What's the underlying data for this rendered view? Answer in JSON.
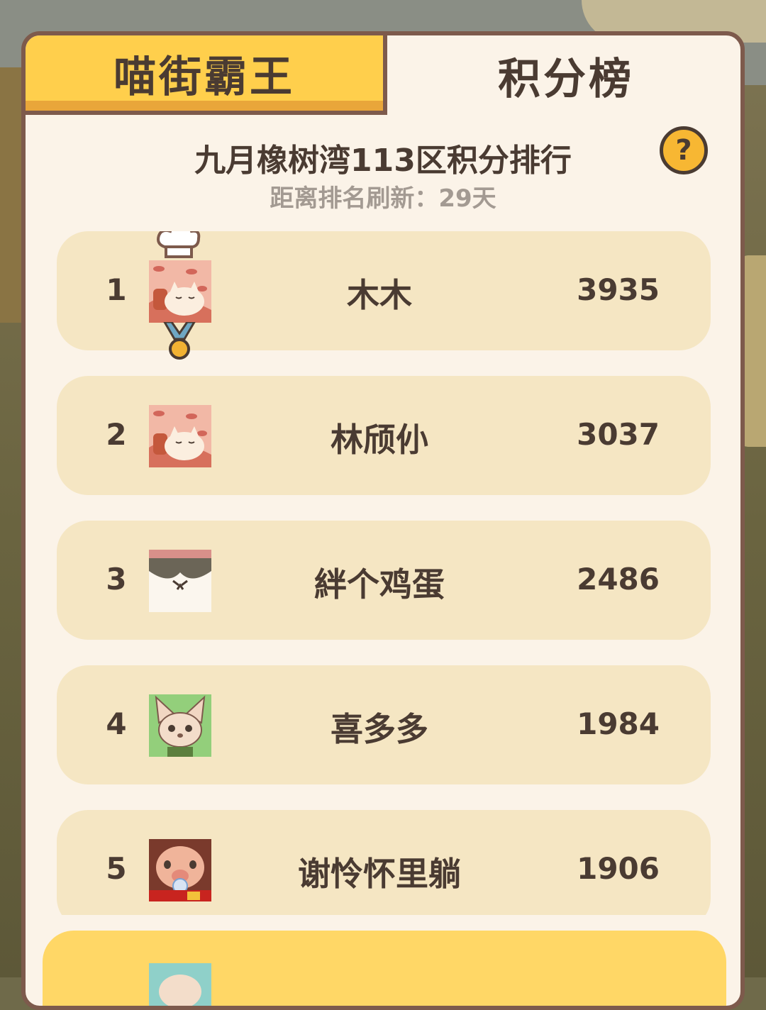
{
  "tabs": [
    {
      "label": "喵街霸王",
      "active": true
    },
    {
      "label": "积分榜",
      "active": false
    }
  ],
  "header": {
    "title": "九月橡树湾113区积分排行",
    "refresh": "距离排名刷新：29天",
    "help_icon": "question-mark-icon"
  },
  "leaderboard": [
    {
      "rank": "1",
      "name": "木木",
      "score": "3935",
      "avatar": "cat-meat-avatar",
      "badges": [
        "chef-hat-icon",
        "gold-medal-icon"
      ]
    },
    {
      "rank": "2",
      "name": "林颀仦",
      "score": "3037",
      "avatar": "cat-meat-avatar"
    },
    {
      "rank": "3",
      "name": "絆个鸡蛋",
      "score": "2486",
      "avatar": "cat-face-avatar"
    },
    {
      "rank": "4",
      "name": "喜多多",
      "score": "1984",
      "avatar": "fox-avatar"
    },
    {
      "rank": "5",
      "name": "谢怜怀里躺",
      "score": "1906",
      "avatar": "pig-avatar"
    }
  ],
  "colors": {
    "active_tab": "#ffcf4c",
    "row_bg": "#f5e6c3",
    "my_row_bg": "#ffd766",
    "text": "#4a3b32",
    "border": "#7d5a4c"
  }
}
